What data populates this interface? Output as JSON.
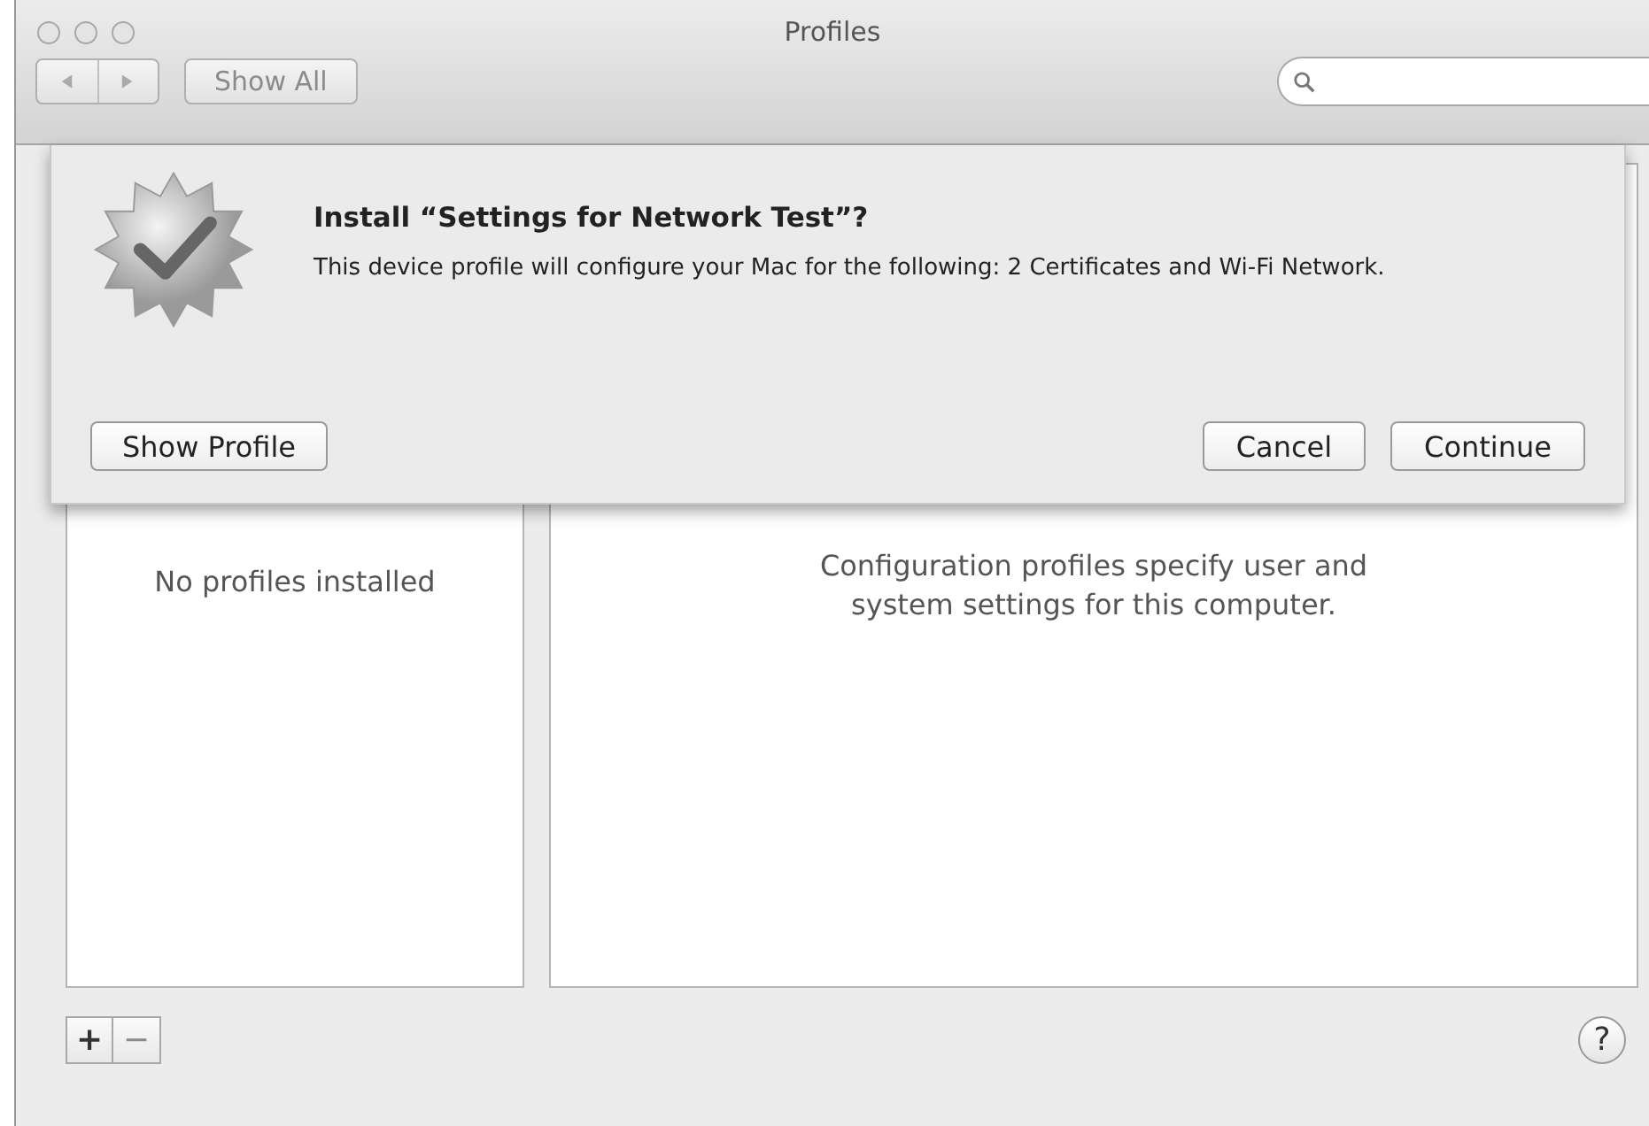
{
  "window": {
    "title": "Profiles"
  },
  "toolbar": {
    "show_all": "Show All"
  },
  "sheet": {
    "title": "Install “Settings for Network Test”?",
    "message": "This device profile will configure your Mac for the following: 2 Certificates and Wi-Fi Network.",
    "buttons": [
      {
        "label": "Show Profile",
        "kind": "left"
      },
      {
        "label": "Cancel",
        "kind": "right"
      },
      {
        "label": "Continue",
        "kind": "right"
      }
    ]
  },
  "profile_list": {
    "empty_text": "No profiles installed"
  },
  "detail": {
    "text": "Configuration profiles specify user and system settings for this computer."
  },
  "bottom_bar": {
    "add": "+",
    "remove": "−",
    "help": "?"
  }
}
